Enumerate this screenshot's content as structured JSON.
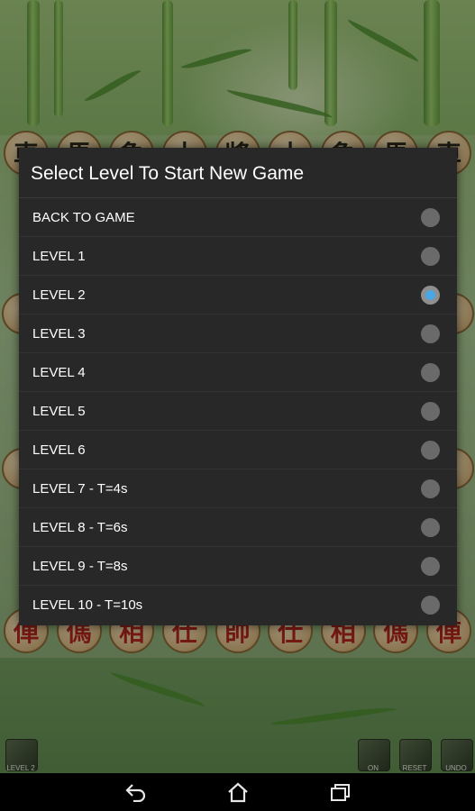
{
  "dialog": {
    "title": "Select Level To Start New Game",
    "options": [
      {
        "label": "BACK TO GAME",
        "checked": false
      },
      {
        "label": "LEVEL 1",
        "checked": false
      },
      {
        "label": "LEVEL 2",
        "checked": true
      },
      {
        "label": "LEVEL 3",
        "checked": false
      },
      {
        "label": "LEVEL 4",
        "checked": false
      },
      {
        "label": "LEVEL 5",
        "checked": false
      },
      {
        "label": "LEVEL 6",
        "checked": false
      },
      {
        "label": "LEVEL 7 - T=4s",
        "checked": false
      },
      {
        "label": "LEVEL 8 - T=6s",
        "checked": false
      },
      {
        "label": "LEVEL 9 - T=8s",
        "checked": false
      },
      {
        "label": "LEVEL 10 - T=10s",
        "checked": false
      }
    ]
  },
  "board": {
    "top_row": [
      "車",
      "馬",
      "象",
      "士",
      "將",
      "士",
      "象",
      "馬",
      "車"
    ],
    "bottom_row": [
      "俥",
      "傌",
      "相",
      "仕",
      "帥",
      "仕",
      "相",
      "傌",
      "俥"
    ]
  },
  "toolbar": {
    "level_label": "LEVEL 2",
    "on_label": "ON",
    "reset_label": "RESET",
    "undo_label": "UNDO"
  },
  "navbar": {
    "icons": [
      "back-icon",
      "home-icon",
      "recent-apps-icon"
    ]
  },
  "colors": {
    "accent": "#4aa7e6",
    "dialog_bg": "#282828",
    "red_piece": "#b2261e",
    "black_piece": "#2c2c1c"
  }
}
